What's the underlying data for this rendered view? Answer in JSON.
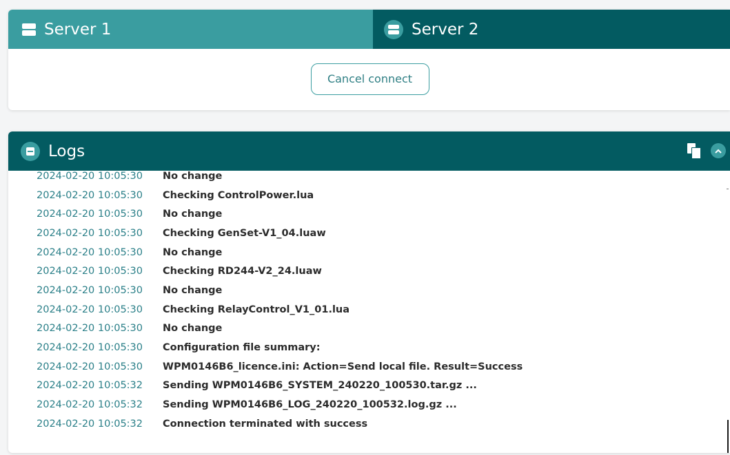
{
  "servers": {
    "tabs": [
      {
        "label": "Server 1",
        "icon": "server-icon",
        "active": true
      },
      {
        "label": "Server 2",
        "icon": "server-icon",
        "active": false
      }
    ],
    "cancel_label": "Cancel connect"
  },
  "logs": {
    "title": "Logs",
    "icons": {
      "header": "log-file-icon",
      "copy": "copy-icon",
      "collapse": "chevron-up-icon"
    },
    "rows": [
      {
        "time": "2024-02-20 10:05:30",
        "message": "No change"
      },
      {
        "time": "2024-02-20 10:05:30",
        "message": "Checking ControlPower.lua"
      },
      {
        "time": "2024-02-20 10:05:30",
        "message": "No change"
      },
      {
        "time": "2024-02-20 10:05:30",
        "message": "Checking GenSet-V1_04.luaw"
      },
      {
        "time": "2024-02-20 10:05:30",
        "message": "No change"
      },
      {
        "time": "2024-02-20 10:05:30",
        "message": "Checking RD244-V2_24.luaw"
      },
      {
        "time": "2024-02-20 10:05:30",
        "message": "No change"
      },
      {
        "time": "2024-02-20 10:05:30",
        "message": "Checking RelayControl_V1_01.lua"
      },
      {
        "time": "2024-02-20 10:05:30",
        "message": "No change"
      },
      {
        "time": "2024-02-20 10:05:30",
        "message": "Configuration file summary:"
      },
      {
        "time": "2024-02-20 10:05:30",
        "message": "WPM0146B6_licence.ini: Action=Send local file. Result=Success"
      },
      {
        "time": "2024-02-20 10:05:32",
        "message": "Sending WPM0146B6_SYSTEM_240220_100530.tar.gz ..."
      },
      {
        "time": "2024-02-20 10:05:32",
        "message": "Sending WPM0146B6_LOG_240220_100532.log.gz ..."
      },
      {
        "time": "2024-02-20 10:05:32",
        "message": "Connection terminated with success"
      }
    ]
  },
  "colors": {
    "tab_active": "#3a9da0",
    "tab_inactive": "#035b61",
    "timestamp": "#2a7f88",
    "message": "#2b2b2b"
  }
}
